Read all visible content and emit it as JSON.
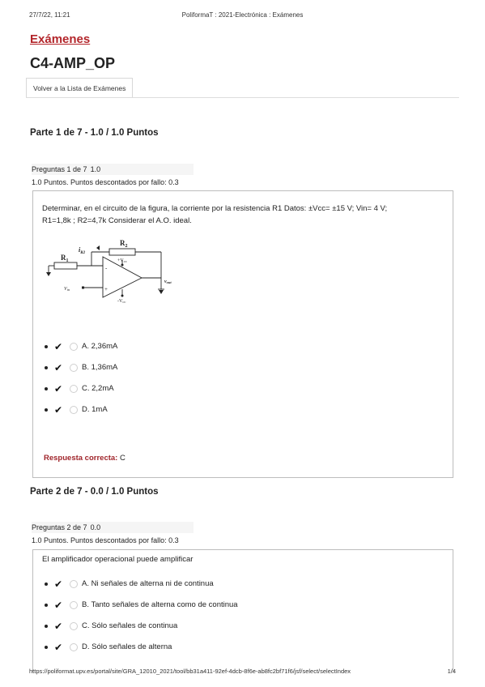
{
  "print": {
    "date": "27/7/22, 11:21",
    "title": "PoliformaT : 2021-Electrónica : Exámenes",
    "url": "https://poliformat.upv.es/portal/site/GRA_12010_2021/tool/bb31a411-92ef-4dcb-8f6e-ab8fc2bf71f6/jsf/select/selectIndex",
    "page": "1/4"
  },
  "header": {
    "section_link": "Exámenes",
    "exam_title": "C4-AMP_OP",
    "back_button": "Volver a la Lista de Exámenes"
  },
  "parts": [
    {
      "title": "Parte 1 de 7 - 1.0 / 1.0 Puntos",
      "question_label": "Preguntas 1 de 7",
      "question_score": "1.0",
      "points_info": "1.0 Puntos. Puntos descontados por fallo: 0.3",
      "text_line1": "Determinar, en el circuito de la figura, la corriente por la resistencia R1 Datos: ±Vcc= ±15 V; Vin= 4 V;",
      "text_line2": "R1=1,8k ; R2=4,7k Considerar el A.O. ideal.",
      "circuit": {
        "r2": "R",
        "r2_sub": "2",
        "r1": "R",
        "r1_sub": "1",
        "ir2": "i",
        "ir2_sub": "R2",
        "vcc_pos": "+V",
        "vcc_pos_sub": "cc",
        "vcc_neg": "-V",
        "vcc_neg_sub": "cc",
        "vin": "V",
        "vin_sub": "in",
        "vout": "v",
        "vout_sub": "out",
        "minus": "-",
        "plus": "+"
      },
      "options": [
        {
          "check": "✔",
          "label": "A. 2,36mA"
        },
        {
          "check": "✔",
          "label": "B. 1,36mA"
        },
        {
          "check": "✔",
          "label": "C. 2,2mA"
        },
        {
          "check": "✔",
          "label": "D. 1mA"
        }
      ],
      "answer_label": "Respuesta correcta:",
      "answer_value": "C"
    },
    {
      "title": "Parte 2 de 7 - 0.0 / 1.0 Puntos",
      "question_label": "Preguntas 2 de 7",
      "question_score": "0.0",
      "points_info": "1.0 Puntos. Puntos descontados por fallo: 0.3",
      "text_line1": "El amplificador operacional puede amplificar",
      "options": [
        {
          "check": "✔",
          "label": "A. Ni señales de alterna ni de continua"
        },
        {
          "check": "✔",
          "label": "B. Tanto señales de alterna como de continua"
        },
        {
          "check": "✔",
          "label": "C. Sólo señales de continua"
        },
        {
          "check": "✔",
          "label": "D. Sólo señales de alterna"
        }
      ]
    }
  ]
}
